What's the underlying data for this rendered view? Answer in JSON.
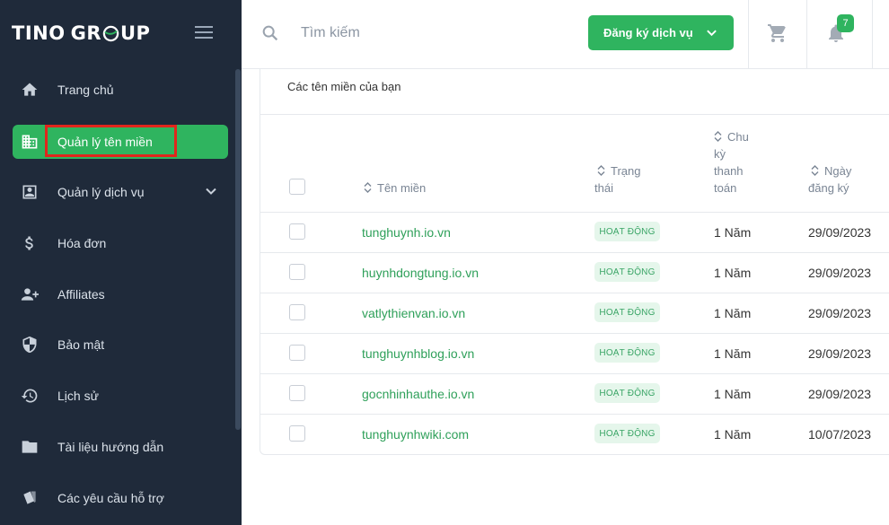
{
  "brand": {
    "logo_left": "TINO",
    "logo_right": "R",
    "logo_mid": "G",
    "logo_end": "UP"
  },
  "sidebar": {
    "items": [
      {
        "label": "Trang chủ",
        "icon": "home-icon"
      },
      {
        "label": "Quản lý tên miền",
        "icon": "building-icon",
        "active": true
      },
      {
        "label": "Quản lý dịch vụ",
        "icon": "id-card-icon",
        "has_submenu": true
      },
      {
        "label": "Hóa đơn",
        "icon": "dollar-icon"
      },
      {
        "label": "Affiliates",
        "icon": "user-plus-icon"
      },
      {
        "label": "Bảo mật",
        "icon": "shield-icon"
      },
      {
        "label": "Lịch sử",
        "icon": "history-icon"
      },
      {
        "label": "Tài liệu hướng dẫn",
        "icon": "folder-icon"
      },
      {
        "label": "Các yêu cầu hỗ trợ",
        "icon": "tickets-icon"
      }
    ]
  },
  "topbar": {
    "search_placeholder": "Tìm kiếm",
    "register_label": "Đăng ký dịch vụ",
    "notification_count": "7"
  },
  "card": {
    "title": "Các tên miền của bạn",
    "columns": {
      "domain": "Tên miền",
      "status_1": "Trạng",
      "status_2": "thái",
      "cycle_1": "Chu",
      "cycle_2": "kỳ",
      "cycle_3": "thanh",
      "cycle_4": "toán",
      "date_1": "Ngày",
      "date_2": "đăng ký"
    },
    "rows": [
      {
        "domain": "tunghuynh.io.vn",
        "status": "HOẠT ĐỘNG",
        "cycle": "1 Năm",
        "date": "29/09/2023"
      },
      {
        "domain": "huynhdongtung.io.vn",
        "status": "HOẠT ĐỘNG",
        "cycle": "1 Năm",
        "date": "29/09/2023"
      },
      {
        "domain": "vatlythienvan.io.vn",
        "status": "HOẠT ĐỘNG",
        "cycle": "1 Năm",
        "date": "29/09/2023"
      },
      {
        "domain": "tunghuynhblog.io.vn",
        "status": "HOẠT ĐỘNG",
        "cycle": "1 Năm",
        "date": "29/09/2023"
      },
      {
        "domain": "gocnhinhauthe.io.vn",
        "status": "HOẠT ĐỘNG",
        "cycle": "1 Năm",
        "date": "29/09/2023"
      },
      {
        "domain": "tunghuynhwiki.com",
        "status": "HOẠT ĐỘNG",
        "cycle": "1 Năm",
        "date": "10/07/2023"
      }
    ]
  },
  "colors": {
    "sidebar_bg": "#1f2a3a",
    "accent": "#2fb45f",
    "highlight": "#e1261c"
  }
}
